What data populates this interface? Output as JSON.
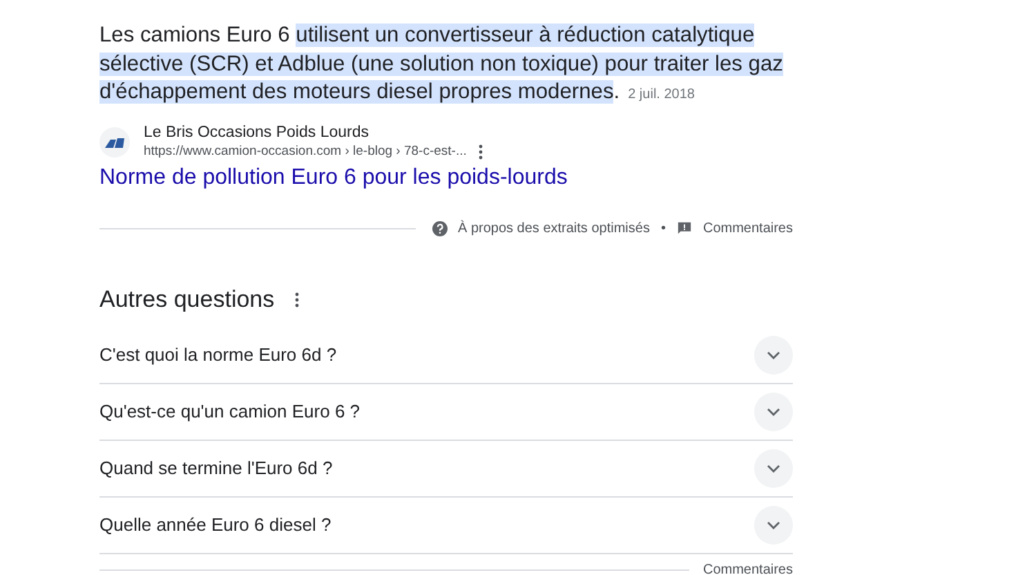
{
  "snippet": {
    "plain": "Les camions Euro 6",
    "highlighted": "utilisent un convertisseur à réduction catalytique sélective (SCR) et Adblue (une solution non toxique) pour traiter les gaz d'échappement des moteurs diesel propres modernes",
    "after": ".",
    "date": "2 juil. 2018"
  },
  "source": {
    "site": "Le Bris Occasions Poids Lourds",
    "url": "https://www.camion-occasion.com › le-blog › 78-c-est-...",
    "title": "Norme de pollution Euro 6 pour les poids-lourds"
  },
  "snippet_footer": {
    "about": "À propos des extraits optimisés",
    "separator": "•",
    "feedback": "Commentaires"
  },
  "questions": {
    "heading": "Autres questions",
    "items": [
      {
        "text": "C'est quoi la norme Euro 6d ?",
        "expanded": false
      },
      {
        "text": "Qu'est-ce qu'un camion Euro 6 ?",
        "expanded": false
      },
      {
        "text": "Quand se termine l'Euro 6d ?",
        "expanded": false
      },
      {
        "text": "Quelle année Euro 6 diesel ?",
        "expanded": false
      }
    ],
    "feedback": "Commentaires"
  }
}
